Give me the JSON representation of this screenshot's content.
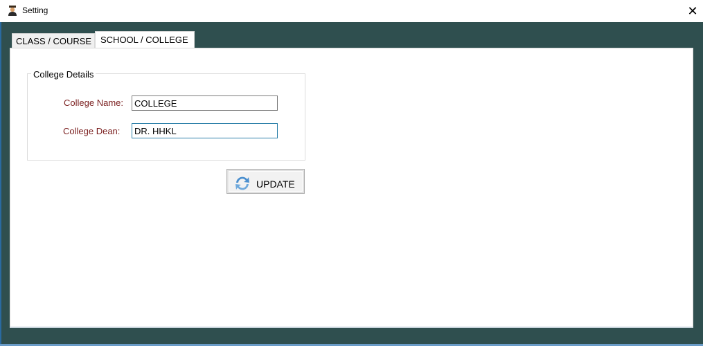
{
  "window": {
    "title": "Setting",
    "app_icon": "graduate-icon",
    "close_icon": "close-icon",
    "close_glyph": "✕"
  },
  "tabs": [
    {
      "label": "CLASS / COURSE",
      "active": false
    },
    {
      "label": "SCHOOL / COLLEGE",
      "active": true
    }
  ],
  "college_details": {
    "legend": "College Details",
    "fields": [
      {
        "label": "College Name:",
        "value": "COLLEGE"
      },
      {
        "label": "College Dean:",
        "value": "DR. HHKL"
      }
    ],
    "update_button": {
      "label": "UPDATE",
      "icon": "refresh-icon"
    }
  },
  "colors": {
    "background": "#2f4f4f",
    "label_text": "#7a1e1e",
    "focused_border": "#2a7fa8"
  }
}
